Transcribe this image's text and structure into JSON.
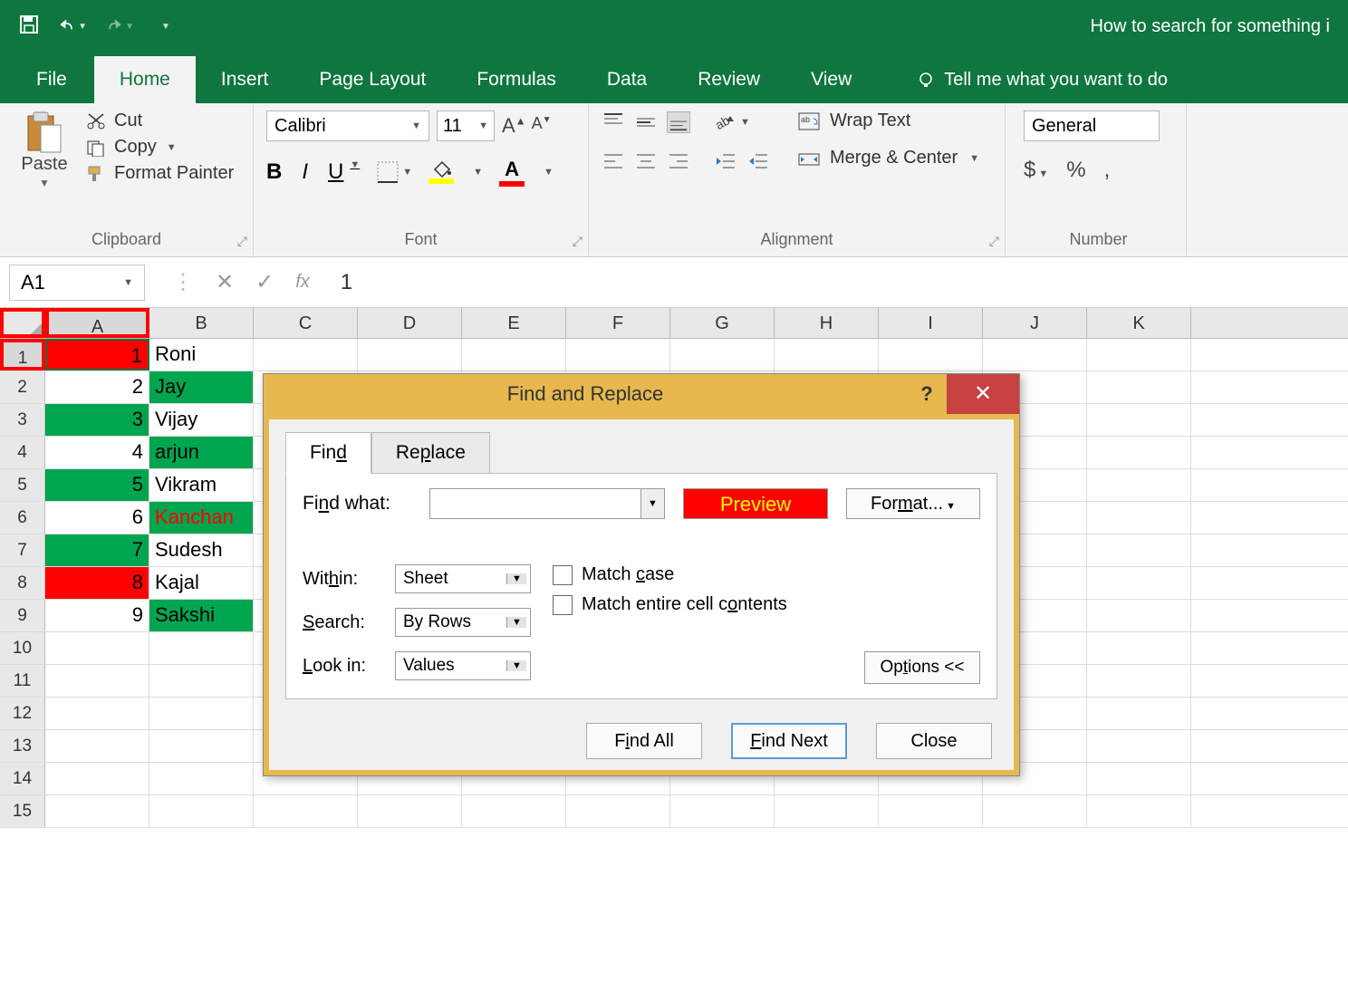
{
  "titlebar": {
    "title": "How to search for something i"
  },
  "tabs": {
    "file": "File",
    "home": "Home",
    "insert": "Insert",
    "pageLayout": "Page Layout",
    "formulas": "Formulas",
    "data": "Data",
    "review": "Review",
    "view": "View",
    "tellMe": "Tell me what you want to do"
  },
  "ribbon": {
    "clipboard": {
      "label": "Clipboard",
      "paste": "Paste",
      "cut": "Cut",
      "copy": "Copy",
      "formatPainter": "Format Painter"
    },
    "font": {
      "label": "Font",
      "name": "Calibri",
      "size": "11",
      "bold": "B",
      "italic": "I",
      "underline": "U",
      "fontColorLetter": "A"
    },
    "alignment": {
      "label": "Alignment",
      "wrap": "Wrap Text",
      "merge": "Merge & Center"
    },
    "number": {
      "label": "Number",
      "format": "General",
      "currency": "$",
      "percent": "%",
      "comma": ","
    }
  },
  "namebox": {
    "ref": "A1"
  },
  "formula": {
    "value": "1"
  },
  "columns": [
    "A",
    "B",
    "C",
    "D",
    "E",
    "F",
    "G",
    "H",
    "I",
    "J",
    "K"
  ],
  "rows": [
    {
      "n": "1",
      "a": "1",
      "aBg": "red",
      "b": "Roni",
      "bBg": ""
    },
    {
      "n": "2",
      "a": "2",
      "aBg": "",
      "b": "Jay",
      "bBg": "green"
    },
    {
      "n": "3",
      "a": "3",
      "aBg": "green",
      "b": "Vijay",
      "bBg": ""
    },
    {
      "n": "4",
      "a": "4",
      "aBg": "",
      "b": "arjun",
      "bBg": "green"
    },
    {
      "n": "5",
      "a": "5",
      "aBg": "green",
      "b": "Vikram",
      "bBg": ""
    },
    {
      "n": "6",
      "a": "6",
      "aBg": "",
      "b": "Kanchan",
      "bBg": "green",
      "bText": "red"
    },
    {
      "n": "7",
      "a": "7",
      "aBg": "green",
      "b": "Sudesh",
      "bBg": ""
    },
    {
      "n": "8",
      "a": "8",
      "aBg": "red",
      "b": "Kajal",
      "bBg": ""
    },
    {
      "n": "9",
      "a": "9",
      "aBg": "",
      "b": "Sakshi",
      "bBg": "green"
    },
    {
      "n": "10"
    },
    {
      "n": "11"
    },
    {
      "n": "12"
    },
    {
      "n": "13"
    },
    {
      "n": "14"
    },
    {
      "n": "15"
    }
  ],
  "dialog": {
    "title": "Find and Replace",
    "tabFind": "Find",
    "tabReplace": "Replace",
    "findWhat": "Find what:",
    "findValue": "",
    "preview": "Preview",
    "format": "Format...",
    "within": "Within:",
    "withinVal": "Sheet",
    "search": "Search:",
    "searchVal": "By Rows",
    "lookIn": "Look in:",
    "lookInVal": "Values",
    "matchCase": "Match case",
    "matchEntire": "Match entire cell contents",
    "options": "Options <<",
    "findAll": "Find All",
    "findNext": "Find Next",
    "close": "Close"
  }
}
